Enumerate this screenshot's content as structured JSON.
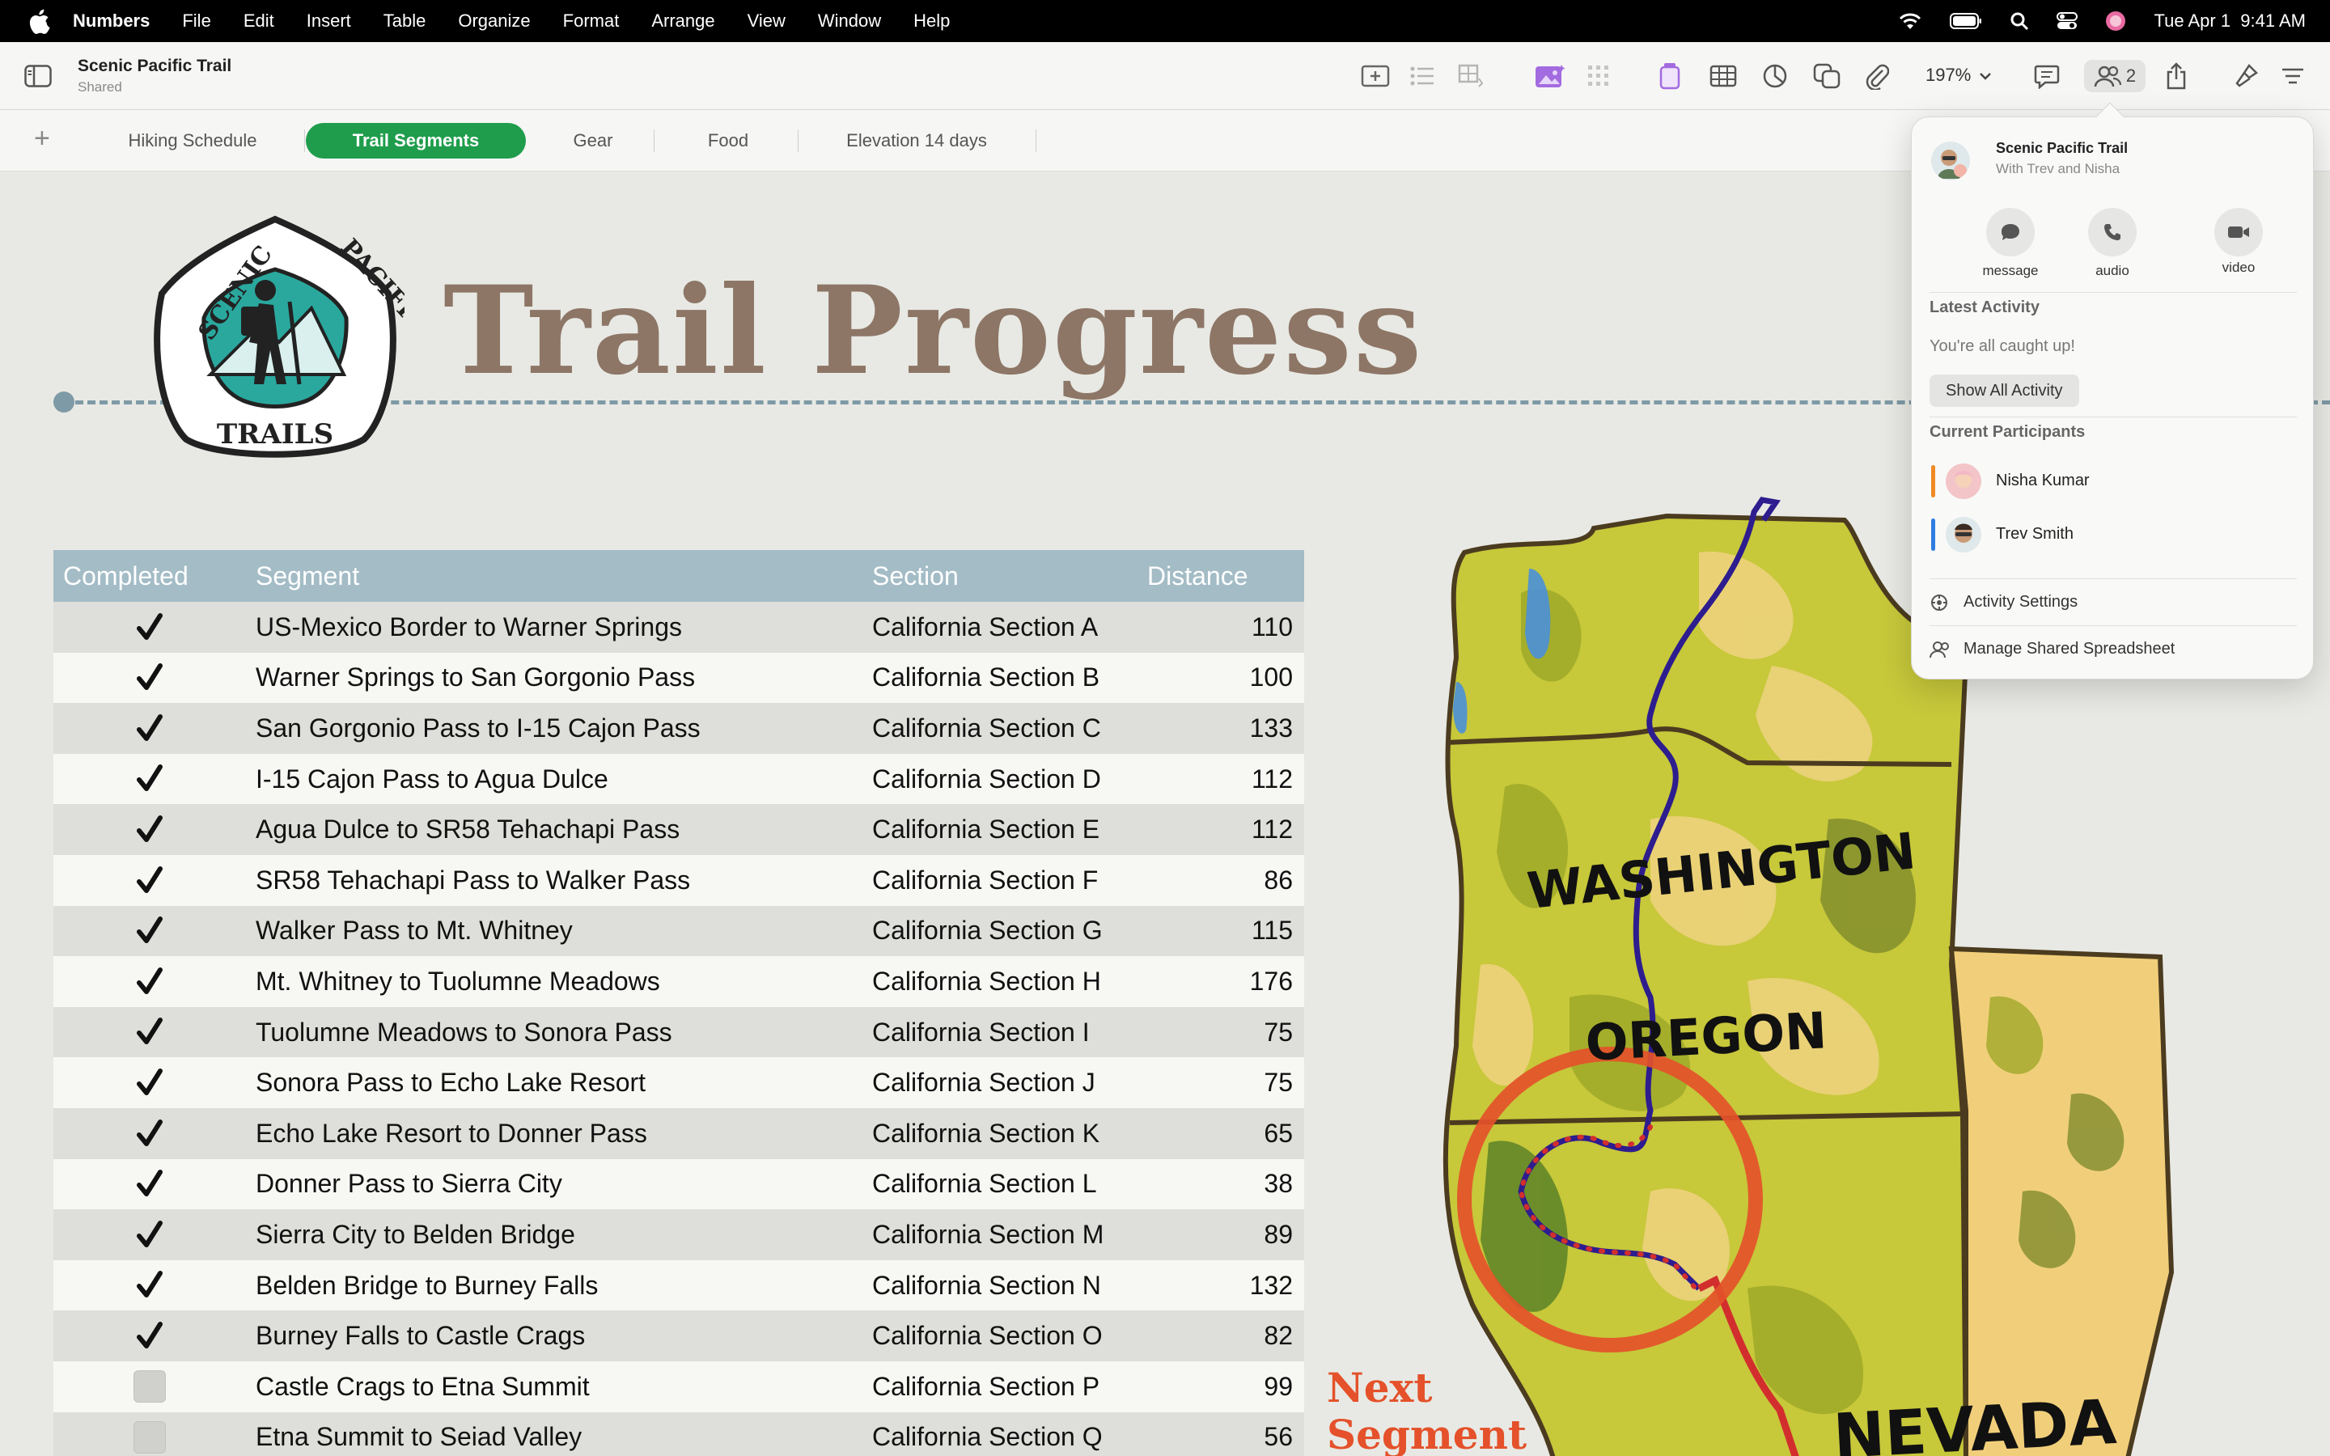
{
  "menubar": {
    "app": "Numbers",
    "items": [
      "File",
      "Edit",
      "Insert",
      "Table",
      "Organize",
      "Format",
      "Arrange",
      "View",
      "Window",
      "Help"
    ],
    "clock": "Tue Apr 1  9:41 AM"
  },
  "toolbar": {
    "doc_title": "Scenic Pacific Trail",
    "doc_subtitle": "Shared",
    "zoom": "197%",
    "collab_count": "2"
  },
  "sheets": {
    "tabs": [
      "Hiking Schedule",
      "Trail Segments",
      "Gear",
      "Food",
      "Elevation 14 days"
    ],
    "active": "Trail Segments"
  },
  "canvas": {
    "title": "Trail Progress",
    "badge": {
      "top": "SCENIC",
      "right": "PACIFIC",
      "bottom": "TRAILS"
    },
    "next_segment": [
      "Next",
      "Segment"
    ]
  },
  "table": {
    "headers": [
      "Completed",
      "Segment",
      "Section",
      "Distance"
    ],
    "rows": [
      {
        "done": true,
        "segment": "US-Mexico Border to Warner Springs",
        "section": "California Section A",
        "distance": "110"
      },
      {
        "done": true,
        "segment": "Warner Springs to San Gorgonio Pass",
        "section": "California Section B",
        "distance": "100"
      },
      {
        "done": true,
        "segment": "San Gorgonio Pass to I-15 Cajon Pass",
        "section": "California Section C",
        "distance": "133"
      },
      {
        "done": true,
        "segment": "I-15 Cajon Pass to Agua Dulce",
        "section": "California Section D",
        "distance": "112"
      },
      {
        "done": true,
        "segment": "Agua Dulce to SR58 Tehachapi Pass",
        "section": "California Section E",
        "distance": "112"
      },
      {
        "done": true,
        "segment": "SR58 Tehachapi Pass to Walker Pass",
        "section": "California Section F",
        "distance": "86"
      },
      {
        "done": true,
        "segment": "Walker Pass to Mt. Whitney",
        "section": "California Section G",
        "distance": "115"
      },
      {
        "done": true,
        "segment": "Mt. Whitney to Tuolumne Meadows",
        "section": "California Section H",
        "distance": "176"
      },
      {
        "done": true,
        "segment": "Tuolumne Meadows to Sonora Pass",
        "section": "California Section I",
        "distance": "75"
      },
      {
        "done": true,
        "segment": "Sonora Pass to Echo Lake Resort",
        "section": "California Section J",
        "distance": "75"
      },
      {
        "done": true,
        "segment": "Echo Lake Resort to Donner Pass",
        "section": "California Section K",
        "distance": "65"
      },
      {
        "done": true,
        "segment": "Donner Pass to Sierra City",
        "section": "California Section L",
        "distance": "38"
      },
      {
        "done": true,
        "segment": "Sierra City to Belden Bridge",
        "section": "California Section M",
        "distance": "89"
      },
      {
        "done": true,
        "segment": "Belden Bridge to Burney Falls",
        "section": "California Section N",
        "distance": "132"
      },
      {
        "done": true,
        "segment": "Burney Falls to Castle Crags",
        "section": "California Section O",
        "distance": "82"
      },
      {
        "done": false,
        "segment": "Castle Crags to Etna Summit",
        "section": "California Section P",
        "distance": "99"
      },
      {
        "done": false,
        "segment": "Etna Summit to Seiad Valley",
        "section": "California Section Q",
        "distance": "56"
      }
    ]
  },
  "map": {
    "states": [
      "WASHINGTON",
      "OREGON",
      "NEVADA"
    ]
  },
  "collab_popover": {
    "title": "Scenic Pacific Trail",
    "subtitle": "With Trev and Nisha",
    "actions": [
      "message",
      "audio",
      "video"
    ],
    "latest_heading": "Latest Activity",
    "latest_text": "You're all caught up!",
    "show_all": "Show All Activity",
    "participants_heading": "Current Participants",
    "participants": [
      {
        "name": "Nisha Kumar",
        "color": "#f08a24"
      },
      {
        "name": "Trev Smith",
        "color": "#2f7de1"
      }
    ],
    "activity_settings": "Activity Settings",
    "manage": "Manage Shared Spreadsheet"
  },
  "colors": {
    "accent_tab": "#1f9d4c",
    "title": "#8d7666",
    "table_header": "#a3bcc6",
    "next_segment": "#e4512a"
  }
}
